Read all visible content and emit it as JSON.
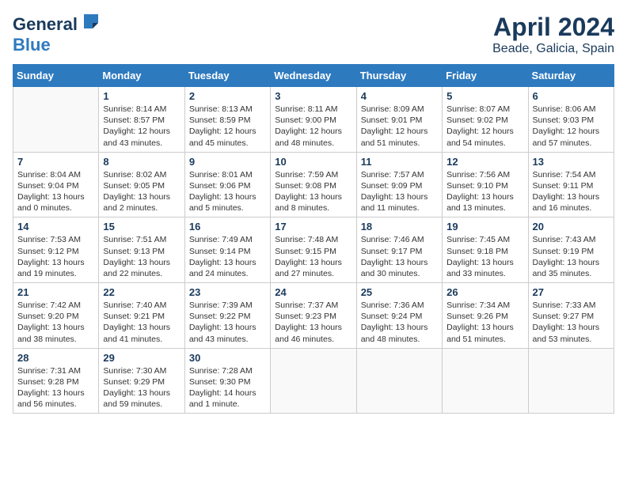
{
  "header": {
    "logo_general": "General",
    "logo_blue": "Blue",
    "month": "April 2024",
    "location": "Beade, Galicia, Spain"
  },
  "weekdays": [
    "Sunday",
    "Monday",
    "Tuesday",
    "Wednesday",
    "Thursday",
    "Friday",
    "Saturday"
  ],
  "weeks": [
    [
      {
        "day": "",
        "info": ""
      },
      {
        "day": "1",
        "info": "Sunrise: 8:14 AM\nSunset: 8:57 PM\nDaylight: 12 hours\nand 43 minutes."
      },
      {
        "day": "2",
        "info": "Sunrise: 8:13 AM\nSunset: 8:59 PM\nDaylight: 12 hours\nand 45 minutes."
      },
      {
        "day": "3",
        "info": "Sunrise: 8:11 AM\nSunset: 9:00 PM\nDaylight: 12 hours\nand 48 minutes."
      },
      {
        "day": "4",
        "info": "Sunrise: 8:09 AM\nSunset: 9:01 PM\nDaylight: 12 hours\nand 51 minutes."
      },
      {
        "day": "5",
        "info": "Sunrise: 8:07 AM\nSunset: 9:02 PM\nDaylight: 12 hours\nand 54 minutes."
      },
      {
        "day": "6",
        "info": "Sunrise: 8:06 AM\nSunset: 9:03 PM\nDaylight: 12 hours\nand 57 minutes."
      }
    ],
    [
      {
        "day": "7",
        "info": "Sunrise: 8:04 AM\nSunset: 9:04 PM\nDaylight: 13 hours\nand 0 minutes."
      },
      {
        "day": "8",
        "info": "Sunrise: 8:02 AM\nSunset: 9:05 PM\nDaylight: 13 hours\nand 2 minutes."
      },
      {
        "day": "9",
        "info": "Sunrise: 8:01 AM\nSunset: 9:06 PM\nDaylight: 13 hours\nand 5 minutes."
      },
      {
        "day": "10",
        "info": "Sunrise: 7:59 AM\nSunset: 9:08 PM\nDaylight: 13 hours\nand 8 minutes."
      },
      {
        "day": "11",
        "info": "Sunrise: 7:57 AM\nSunset: 9:09 PM\nDaylight: 13 hours\nand 11 minutes."
      },
      {
        "day": "12",
        "info": "Sunrise: 7:56 AM\nSunset: 9:10 PM\nDaylight: 13 hours\nand 13 minutes."
      },
      {
        "day": "13",
        "info": "Sunrise: 7:54 AM\nSunset: 9:11 PM\nDaylight: 13 hours\nand 16 minutes."
      }
    ],
    [
      {
        "day": "14",
        "info": "Sunrise: 7:53 AM\nSunset: 9:12 PM\nDaylight: 13 hours\nand 19 minutes."
      },
      {
        "day": "15",
        "info": "Sunrise: 7:51 AM\nSunset: 9:13 PM\nDaylight: 13 hours\nand 22 minutes."
      },
      {
        "day": "16",
        "info": "Sunrise: 7:49 AM\nSunset: 9:14 PM\nDaylight: 13 hours\nand 24 minutes."
      },
      {
        "day": "17",
        "info": "Sunrise: 7:48 AM\nSunset: 9:15 PM\nDaylight: 13 hours\nand 27 minutes."
      },
      {
        "day": "18",
        "info": "Sunrise: 7:46 AM\nSunset: 9:17 PM\nDaylight: 13 hours\nand 30 minutes."
      },
      {
        "day": "19",
        "info": "Sunrise: 7:45 AM\nSunset: 9:18 PM\nDaylight: 13 hours\nand 33 minutes."
      },
      {
        "day": "20",
        "info": "Sunrise: 7:43 AM\nSunset: 9:19 PM\nDaylight: 13 hours\nand 35 minutes."
      }
    ],
    [
      {
        "day": "21",
        "info": "Sunrise: 7:42 AM\nSunset: 9:20 PM\nDaylight: 13 hours\nand 38 minutes."
      },
      {
        "day": "22",
        "info": "Sunrise: 7:40 AM\nSunset: 9:21 PM\nDaylight: 13 hours\nand 41 minutes."
      },
      {
        "day": "23",
        "info": "Sunrise: 7:39 AM\nSunset: 9:22 PM\nDaylight: 13 hours\nand 43 minutes."
      },
      {
        "day": "24",
        "info": "Sunrise: 7:37 AM\nSunset: 9:23 PM\nDaylight: 13 hours\nand 46 minutes."
      },
      {
        "day": "25",
        "info": "Sunrise: 7:36 AM\nSunset: 9:24 PM\nDaylight: 13 hours\nand 48 minutes."
      },
      {
        "day": "26",
        "info": "Sunrise: 7:34 AM\nSunset: 9:26 PM\nDaylight: 13 hours\nand 51 minutes."
      },
      {
        "day": "27",
        "info": "Sunrise: 7:33 AM\nSunset: 9:27 PM\nDaylight: 13 hours\nand 53 minutes."
      }
    ],
    [
      {
        "day": "28",
        "info": "Sunrise: 7:31 AM\nSunset: 9:28 PM\nDaylight: 13 hours\nand 56 minutes."
      },
      {
        "day": "29",
        "info": "Sunrise: 7:30 AM\nSunset: 9:29 PM\nDaylight: 13 hours\nand 59 minutes."
      },
      {
        "day": "30",
        "info": "Sunrise: 7:28 AM\nSunset: 9:30 PM\nDaylight: 14 hours\nand 1 minute."
      },
      {
        "day": "",
        "info": ""
      },
      {
        "day": "",
        "info": ""
      },
      {
        "day": "",
        "info": ""
      },
      {
        "day": "",
        "info": ""
      }
    ]
  ]
}
